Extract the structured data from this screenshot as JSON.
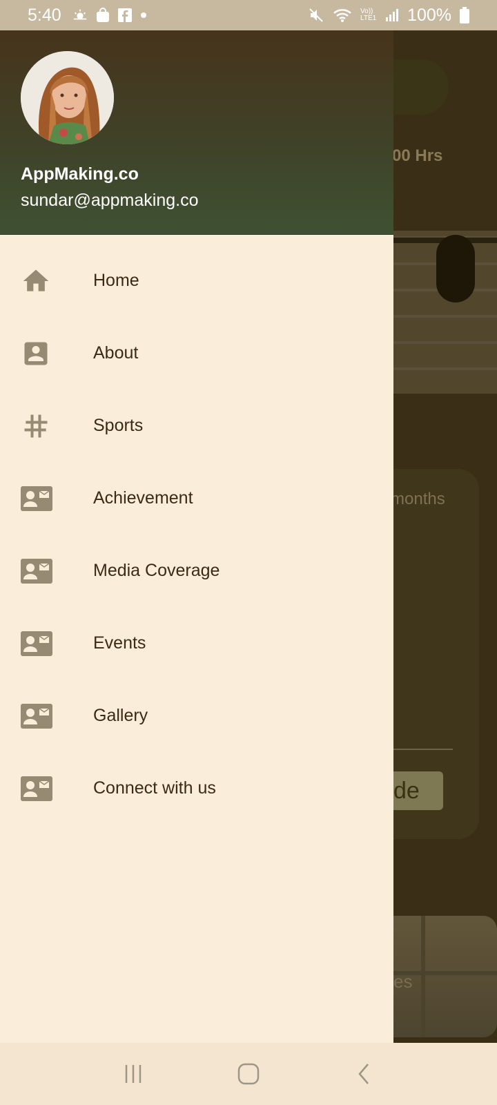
{
  "status_bar": {
    "time": "5:40",
    "battery": "100%",
    "network": "Vo)) LTE1"
  },
  "background": {
    "hours_text": ":00 Hrs",
    "months_text": "months",
    "button_text": "de",
    "card_text": "es"
  },
  "drawer": {
    "user_name": "AppMaking.co",
    "user_email": "sundar@appmaking.co",
    "menu": [
      {
        "label": "Home",
        "icon": "home-icon"
      },
      {
        "label": "About",
        "icon": "account-box-icon"
      },
      {
        "label": "Sports",
        "icon": "hashtag-icon"
      },
      {
        "label": "Achievement",
        "icon": "contact-mail-icon"
      },
      {
        "label": "Media Coverage",
        "icon": "contact-mail-icon"
      },
      {
        "label": "Events",
        "icon": "contact-mail-icon"
      },
      {
        "label": "Gallery",
        "icon": "contact-mail-icon"
      },
      {
        "label": "Connect with us",
        "icon": "contact-mail-icon"
      }
    ]
  },
  "colors": {
    "drawer_bg": "#faeedb",
    "header_start": "#47341c",
    "header_end": "#3f5132",
    "icon": "#968a73",
    "text": "#3b2a14"
  }
}
